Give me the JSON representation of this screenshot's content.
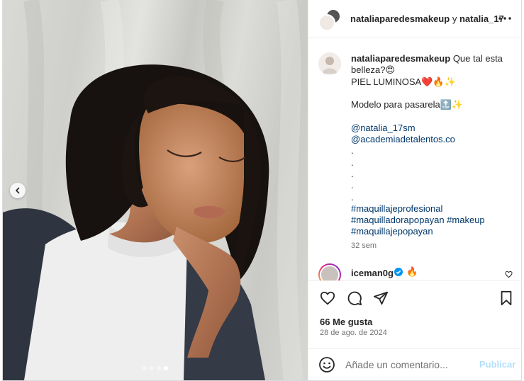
{
  "post": {
    "header": {
      "author": "nataliaparedesmakeup",
      "conjunction": "y",
      "collaborator": "natalia_17"
    },
    "caption": {
      "author": "nataliaparedesmakeup",
      "line1": "Que tal esta",
      "line2": "belleza?😍",
      "line3": "PIEL LUMINOSA❤️🔥✨",
      "line4": "Modelo para pasarela🔝✨",
      "mention1": "@natalia_17sm",
      "mention2": "@academiadetalentos.co",
      "dot": ".",
      "hashtag1": "#maquillajeprofesional",
      "hashtag2": "#maquilladorapopayan",
      "hashtag3": "#makeup",
      "hashtag4": "#maquillajepopayan",
      "time": "32 sem"
    },
    "comment": {
      "user": "iceman0g",
      "text": "🔥"
    },
    "likes": "66 Me gusta",
    "date": "28 de ago. de 2024",
    "composer": {
      "placeholder": "Añade un comentario...",
      "publish_label": "Publicar"
    },
    "carousel": {
      "slide_count": 4,
      "active_slide": 4
    }
  },
  "icons": {
    "more": "more-horizontal-icon",
    "verified": "verified-badge-icon",
    "like": "heart-icon",
    "comment": "comment-bubble-icon",
    "share": "send-icon",
    "save": "bookmark-icon",
    "emoji": "emoji-smile-icon",
    "prev": "chevron-left-icon"
  },
  "colors": {
    "link": "#00376b",
    "verified": "#0095f6",
    "publish_disabled": "#b2dffc",
    "secondary_text": "#737373"
  }
}
